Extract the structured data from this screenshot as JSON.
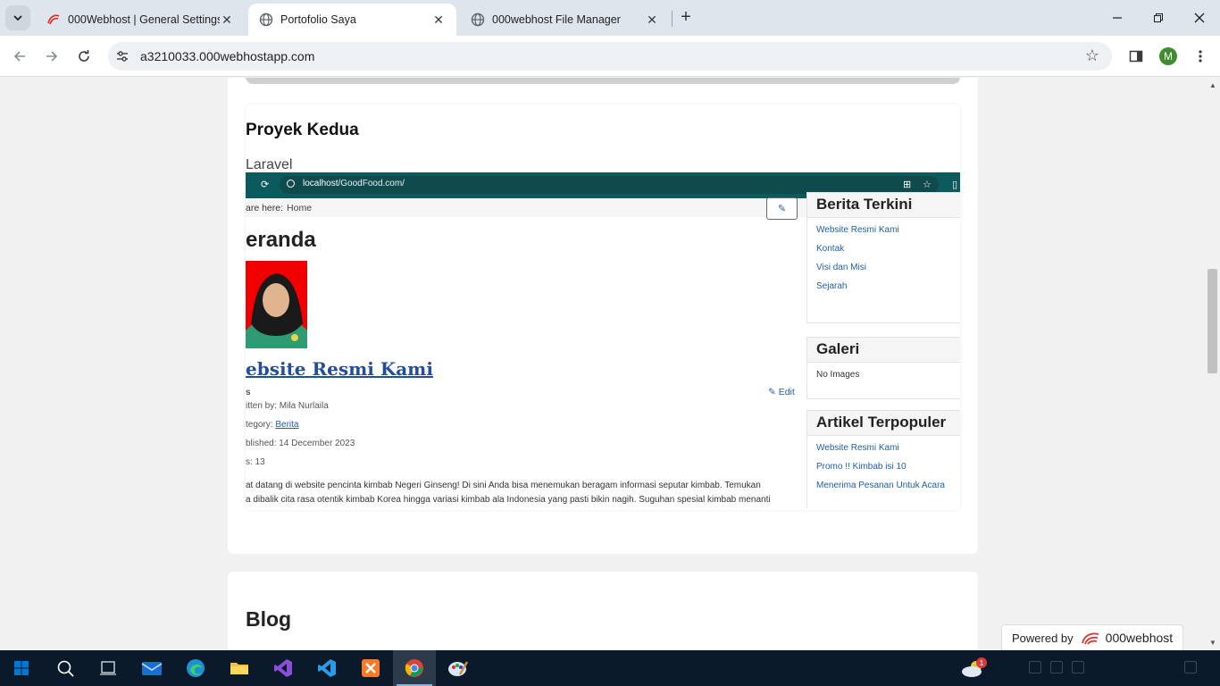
{
  "browser": {
    "tabs": [
      {
        "title": "000Webhost | General Settings",
        "active": false
      },
      {
        "title": "Portofolio Saya",
        "active": true
      },
      {
        "title": "000webhost File Manager",
        "active": false
      }
    ],
    "url": "a3210033.000webhostapp.com",
    "profile_initial": "M"
  },
  "project": {
    "title": "Proyek Kedua",
    "tech": "Laravel",
    "screenshot": {
      "url_host": "localhost",
      "url_path": "/GoodFood.com/",
      "breadcrumb_prefix": "are here:",
      "breadcrumb_home": "Home",
      "page_heading": "eranda",
      "article_title": "ebsite Resmi Kami",
      "edit_label": "Edit",
      "meta_s": "s",
      "meta_written": "itten by: Mila Nurlaila",
      "meta_category_prefix": "tegory:",
      "meta_category": "Berita",
      "meta_published": "blished: 14 December 2023",
      "meta_hits": "s: 13",
      "body_line1": "at datang di website pencinta kimbab Negeri Ginseng! Di sini Anda bisa menemukan beragam informasi seputar kimbab. Temukan",
      "body_line2": "a dibalik cita rasa otentik kimbab Korea hingga variasi kimbab ala Indonesia yang pasti bikin nagih. Suguhan spesial kimbab menanti",
      "sidebar": {
        "berita_title": "Berita Terkini",
        "berita_links": [
          "Website Resmi Kami",
          "Kontak",
          "Visi dan Misi",
          "Sejarah"
        ],
        "galeri_title": "Galeri",
        "galeri_text": "No Images",
        "artikel_title": "Artikel Terpopuler",
        "artikel_links": [
          "Website Resmi Kami",
          "Promo !! Kimbab isi 10",
          "Menerima Pesanan Untuk Acara"
        ]
      }
    }
  },
  "blog": {
    "title": "Blog"
  },
  "powered": {
    "prefix": "Powered by",
    "brand": "000webhost"
  },
  "taskbar": {
    "weather_badge": "1"
  },
  "colors": {
    "accent_teal": "#0a5a5e",
    "link_blue": "#1f5ea8",
    "brand_red": "#e0302a"
  }
}
